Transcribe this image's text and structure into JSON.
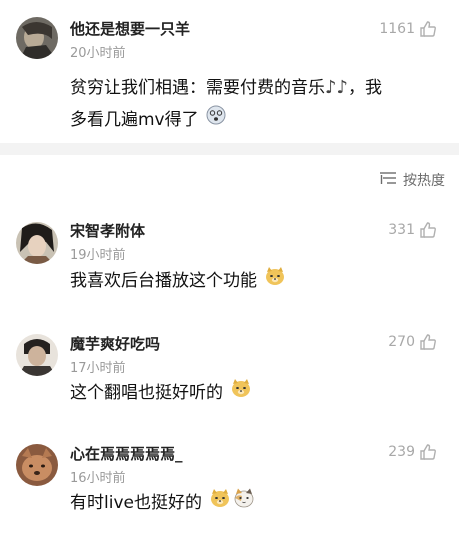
{
  "top_comment": {
    "username": "他还是想要一只羊",
    "time": "20小时前",
    "likes": "1161",
    "text_line1": "贫穷让我们相遇：需要付费的音乐",
    "text_line1_suffix": "，我",
    "text_line2": "多看几遍mv得了"
  },
  "sort_bar": {
    "label": "按热度"
  },
  "comments": [
    {
      "username": "宋智孝附体",
      "time": "19小时前",
      "likes": "331",
      "text": "我喜欢后台播放这个功能"
    },
    {
      "username": "魔芋爽好吃吗",
      "time": "17小时前",
      "likes": "270",
      "text": "这个翻唱也挺好听的"
    },
    {
      "username": "心在焉焉焉焉焉_",
      "time": "16小时前",
      "likes": "239",
      "text": "有时live也挺好的"
    }
  ],
  "colors": {
    "username": "#222222",
    "meta": "#9a9a9a",
    "like_icon": "#a8a8a8",
    "separator_band": "#f3f3f3"
  }
}
